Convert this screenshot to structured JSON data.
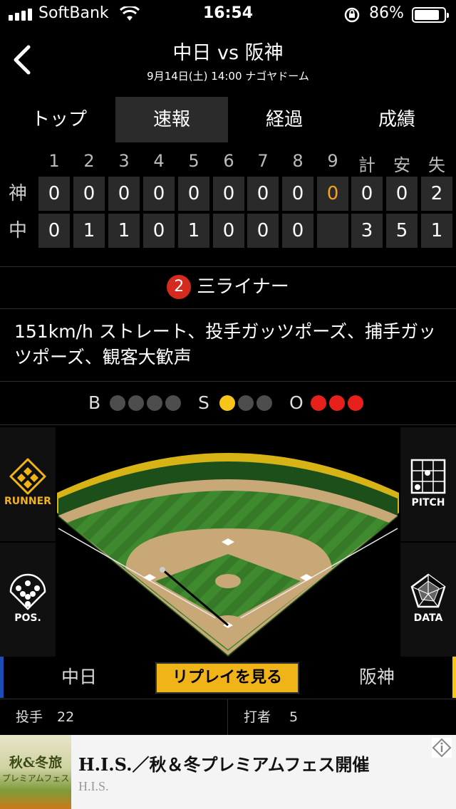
{
  "status_bar": {
    "carrier": "SoftBank",
    "time": "16:54",
    "battery_pct": "86%",
    "battery_level": 0.86
  },
  "header": {
    "title": "中日 vs 阪神",
    "subtitle": "9月14日(土) 14:00 ナゴヤドーム"
  },
  "tabs": [
    {
      "label": "トップ",
      "active": false
    },
    {
      "label": "速報",
      "active": true
    },
    {
      "label": "経過",
      "active": false
    },
    {
      "label": "成績",
      "active": false
    }
  ],
  "scoreboard": {
    "headers": [
      "1",
      "2",
      "3",
      "4",
      "5",
      "6",
      "7",
      "8",
      "9",
      "計",
      "安",
      "失"
    ],
    "rows": [
      {
        "team": "神",
        "cells": [
          "0",
          "0",
          "0",
          "0",
          "0",
          "0",
          "0",
          "0",
          "0",
          "0",
          "0",
          "2"
        ]
      },
      {
        "team": "中",
        "cells": [
          "0",
          "1",
          "1",
          "0",
          "1",
          "0",
          "0",
          "0",
          "",
          "3",
          "5",
          "1"
        ]
      }
    ]
  },
  "play": {
    "outs_badge": "2",
    "result": "三ライナー",
    "description": "151km/h ストレート、投手ガッツポーズ、捕手ガッツポーズ、観客大歓声"
  },
  "count": {
    "b_label": "B",
    "s_label": "S",
    "o_label": "O",
    "balls": 0,
    "strikes": 1,
    "outs": 3,
    "colors": {
      "strike": "#f5c518",
      "out": "#e8201b",
      "off": "#4d4d4d"
    }
  },
  "side_buttons": {
    "runner": "RUNNER",
    "pitch": "PITCH",
    "pos": "POS.",
    "data": "DATA"
  },
  "team_bar": {
    "home": "中日",
    "away": "阪神",
    "replay": "リプレイを見る",
    "colors": {
      "home": "#1c4fb5",
      "away": "#f5c518",
      "replay": "#f0b418"
    }
  },
  "players": {
    "pitcher_label": "投手",
    "pitcher_no": "22",
    "batter_label": "打者",
    "batter_no": "5"
  },
  "ad": {
    "image_text_1": "秋&冬旅",
    "image_text_2": "プレミアムフェス",
    "title": "H.I.S.／秋＆冬プレミアムフェス開催",
    "sponsor": "H.I.S."
  }
}
